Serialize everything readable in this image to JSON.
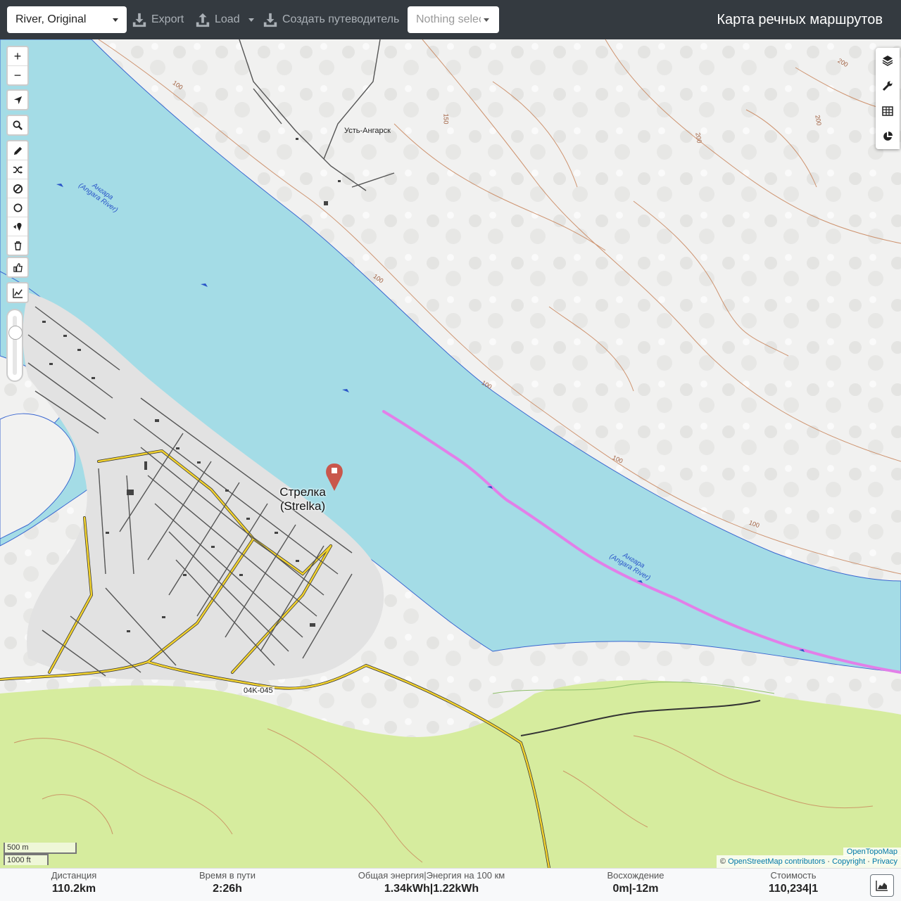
{
  "topbar": {
    "profile_value": "River, Original",
    "export_label": "Export",
    "load_label": "Load",
    "guide_label": "Создать путеводитель",
    "nothing_selected": "Nothing selected",
    "app_title": "Карта речных маршрутов"
  },
  "map": {
    "labels": {
      "settlement_north": "Усть-Ангарск",
      "town_name": "Стрелка",
      "town_name_latin": "(Strelka)",
      "river_name": "Ангара",
      "river_name_latin": "(Angara River)",
      "road_ref": "04K-045",
      "contour_100": "100",
      "contour_150": "150",
      "contour_200": "200"
    },
    "zoom_controls": {
      "zoom_in": "+",
      "zoom_out": "−"
    },
    "scale": {
      "metric": "500 m",
      "imperial": "1000 ft"
    },
    "attribution": {
      "tiles": "OpenTopoMap",
      "copyright_symbol": "©",
      "osm": "OpenStreetMap contributors",
      "sep1": "·",
      "copyright": "Copyright",
      "sep2": "·",
      "privacy": "Privacy"
    },
    "colors": {
      "water": "#a4dce6",
      "route": "#e27fe8",
      "forest": "#d6ec9e",
      "contour": "#c8845a",
      "marker": "#c9574c"
    }
  },
  "stats": {
    "distance_label": "Дистанция",
    "distance_value": "110.2",
    "distance_unit": "km",
    "time_label": "Время в пути",
    "time_value": "2:26",
    "time_unit": "h",
    "energy_label": "Общая энергия|Энергия на 100 км",
    "energy_total": "1.34",
    "energy_total_unit": "kWh",
    "energy_sep": "|",
    "energy_per100": "1.22",
    "energy_per100_unit": "kWh",
    "ascent_label": "Восхождение",
    "ascent_up": "0",
    "ascent_up_unit": "m",
    "ascent_sep": "|",
    "ascent_down": "-12",
    "ascent_down_unit": "m",
    "cost_label": "Стоимость",
    "cost_value": "110,234",
    "cost_sep": "|",
    "cost_count": "1"
  }
}
